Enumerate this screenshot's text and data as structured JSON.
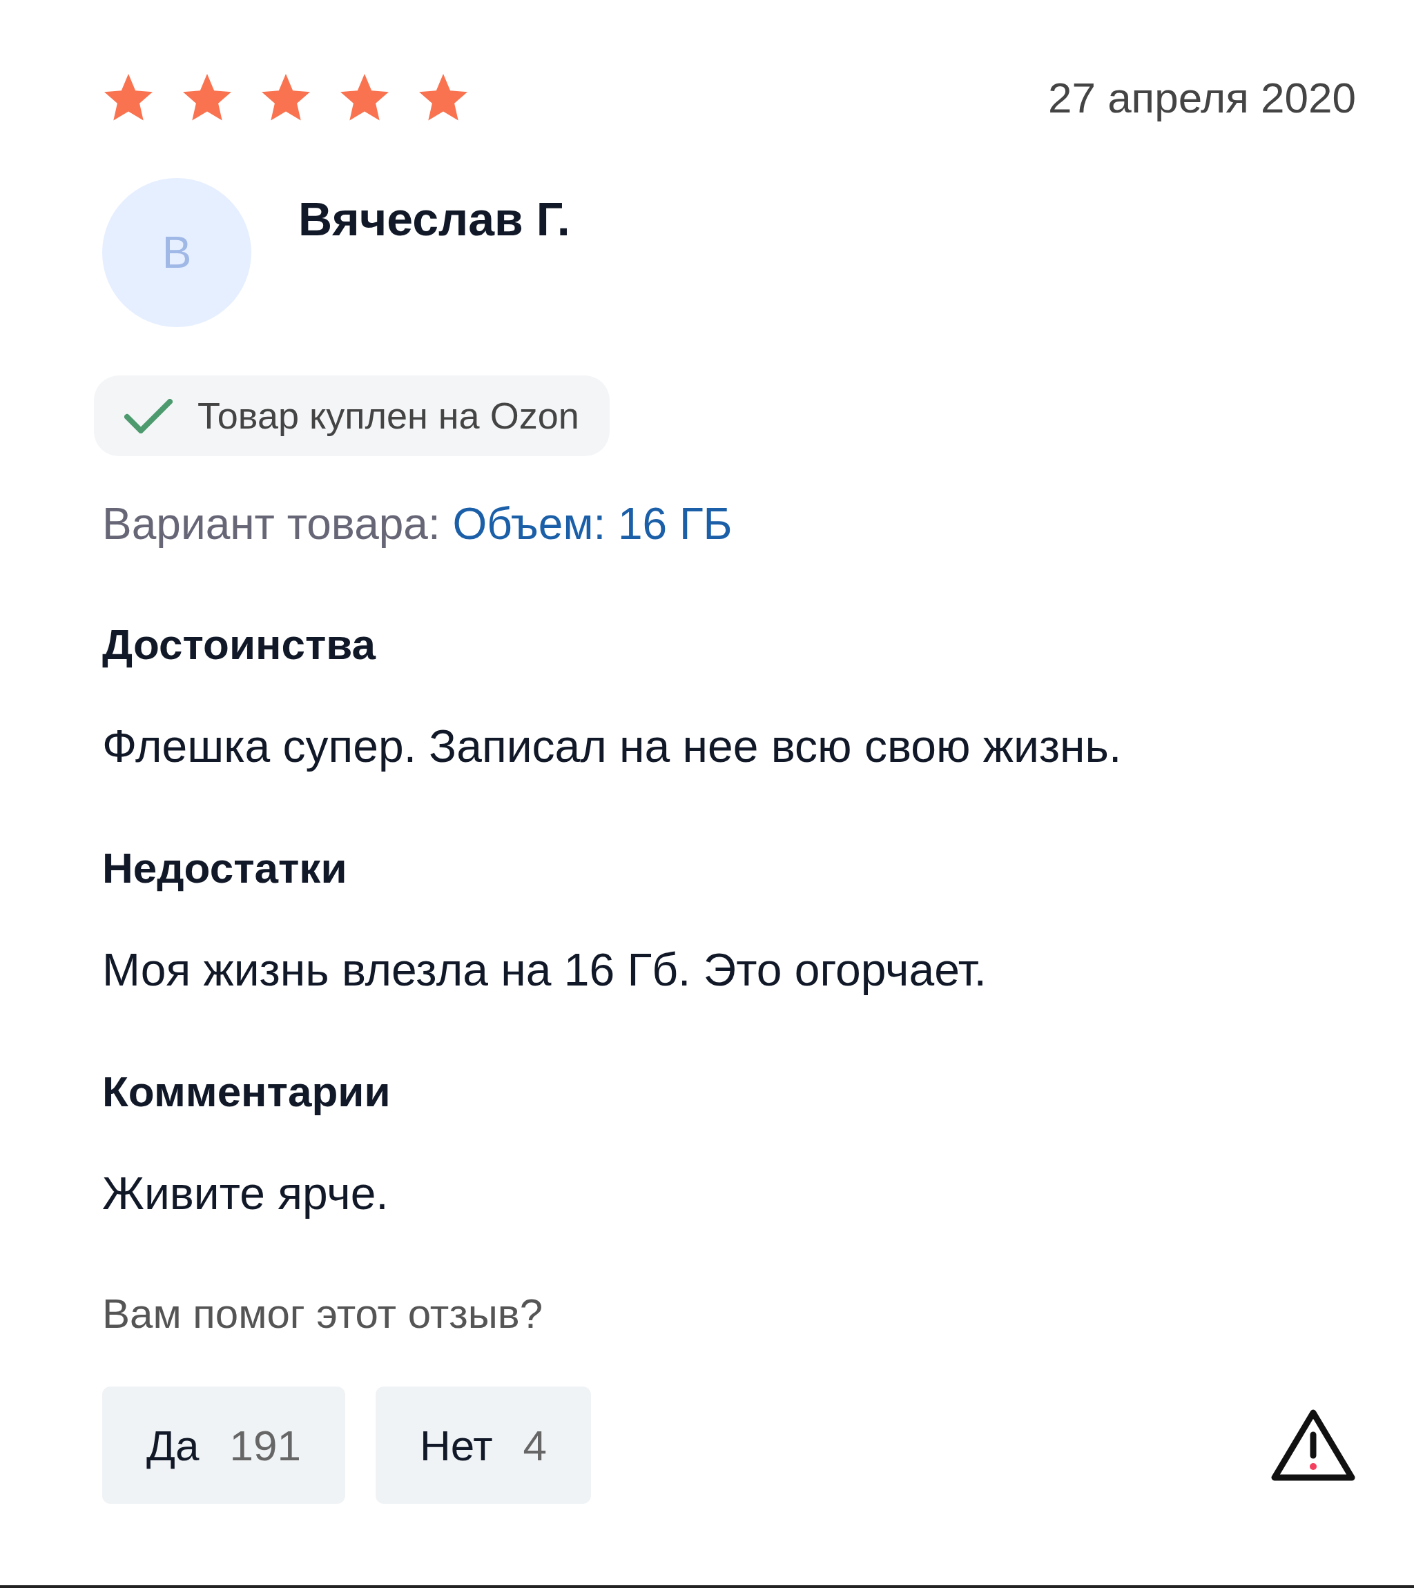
{
  "review": {
    "stars": 5,
    "date": "27 апреля 2020",
    "avatar_letter": "В",
    "author": "Вячеслав Г.",
    "badge": "Товар куплен на Ozon",
    "variant_label": "Вариант товара:",
    "variant_value": "Объем: 16 ГБ"
  },
  "sections": [
    {
      "heading": "Достоинства",
      "text": "Флешка супер. Записал на нее всю свою жизнь."
    },
    {
      "heading": "Недостатки",
      "text": "Моя жизнь влезла на 16 Гб. Это огорчает."
    },
    {
      "heading": "Комментарии",
      "text": "Живите ярче."
    }
  ],
  "helpful": {
    "question": "Вам помог этот отзыв?",
    "buttons": [
      {
        "label": "Да",
        "count": "191"
      },
      {
        "label": "Нет",
        "count": "4"
      }
    ]
  }
}
